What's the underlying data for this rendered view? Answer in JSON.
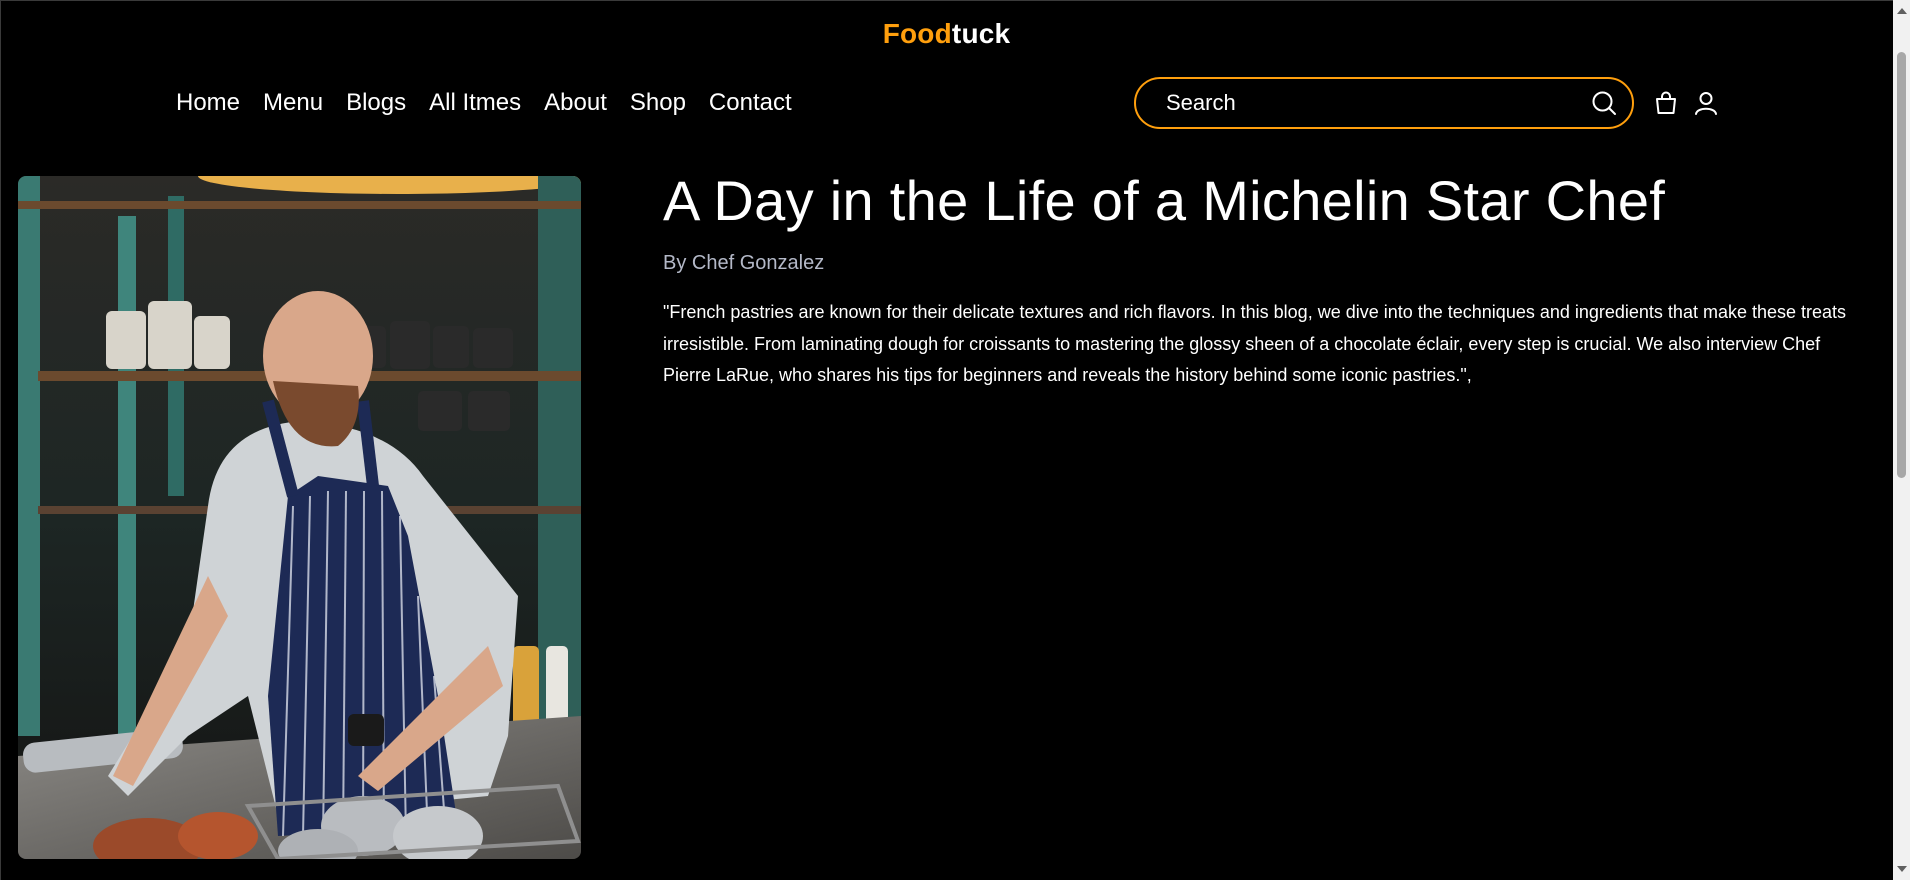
{
  "brand": {
    "logo_accent": "Food",
    "logo_rest": "tuck",
    "accent_color": "#FF9F0D"
  },
  "nav": {
    "items": [
      {
        "label": "Home"
      },
      {
        "label": "Menu"
      },
      {
        "label": "Blogs"
      },
      {
        "label": "All Itmes"
      },
      {
        "label": "About"
      },
      {
        "label": "Shop"
      },
      {
        "label": "Contact"
      }
    ]
  },
  "search": {
    "placeholder": "Search",
    "value": ""
  },
  "icons": {
    "search": "search-icon",
    "cart": "shopping-bag-icon",
    "user": "user-icon"
  },
  "post": {
    "image_alt": "Chef in striped apron preparing food in a restaurant kitchen",
    "title": "A Day in the Life of a Michelin Star Chef",
    "author": "By Chef Gonzalez",
    "body": "\"French pastries are known for their delicate textures and rich flavors. In this blog, we dive into the techniques and ingredients that make these treats irresistible. From laminating dough for croissants to mastering the glossy sheen of a chocolate éclair, every step is crucial. We also interview Chef Pierre LaRue, who shares his tips for beginners and reveals the history behind some iconic pastries.\","
  }
}
